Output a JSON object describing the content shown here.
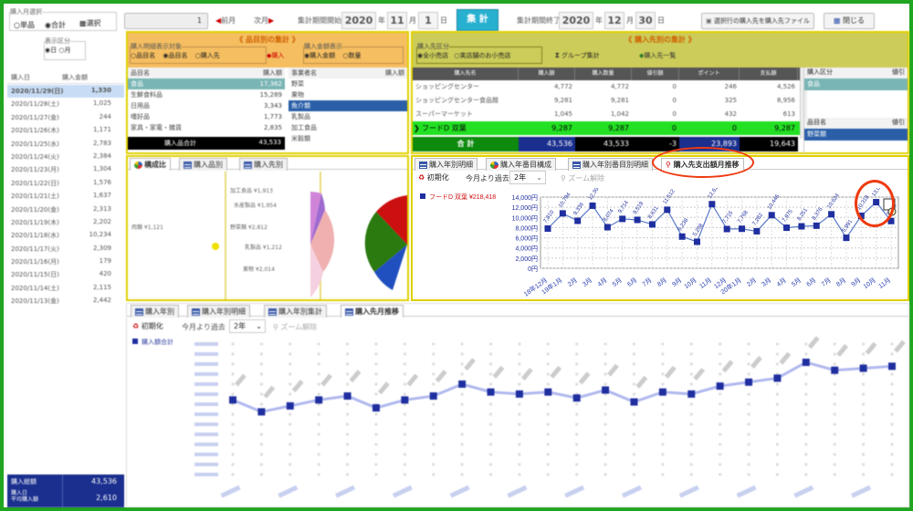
{
  "top": {
    "group1_legend": "購入月選択",
    "radio1": "単品",
    "radio2": "合計",
    "btn_cal": "選択",
    "field_left": "1",
    "nav_prev": "前月",
    "nav_next": "次月",
    "start_label": "集計期間開始",
    "start_year": "2020",
    "start_month": "11",
    "start_day": "1",
    "unit_year": "年",
    "unit_month": "月",
    "unit_day": "日",
    "aggregate_button": "集 計",
    "end_label": "集計期間終了",
    "end_year": "2020",
    "end_month": "12",
    "end_day": "30",
    "btn_export": "選択行の購入先を購入先ファイル出力",
    "btn_close": "閉じる"
  },
  "left": {
    "radio_legend": "表示区分",
    "radio_a": "日",
    "radio_b": "月",
    "col_date": "購入日",
    "col_amount": "購入金額",
    "rows": [
      {
        "date": "2020/11/29(日)",
        "amount": "1,330"
      },
      {
        "date": "2020/11/28(土)",
        "amount": "1,025"
      },
      {
        "date": "2020/11/27(金)",
        "amount": "244"
      },
      {
        "date": "2020/11/26(木)",
        "amount": "1,171"
      },
      {
        "date": "2020/11/25(水)",
        "amount": "2,783"
      },
      {
        "date": "2020/11/24(火)",
        "amount": "2,384"
      },
      {
        "date": "2020/11/23(月)",
        "amount": "1,304"
      },
      {
        "date": "2020/11/22(日)",
        "amount": "1,576"
      },
      {
        "date": "2020/11/21(土)",
        "amount": "1,637"
      },
      {
        "date": "2020/11/20(金)",
        "amount": "2,313"
      },
      {
        "date": "2020/11/19(木)",
        "amount": "2,202"
      },
      {
        "date": "2020/11/18(水)",
        "amount": "10,234"
      },
      {
        "date": "2020/11/17(火)",
        "amount": "2,309"
      },
      {
        "date": "2020/11/16(月)",
        "amount": "179"
      },
      {
        "date": "2020/11/15(日)",
        "amount": "420"
      },
      {
        "date": "2020/11/14(土)",
        "amount": "2,115"
      },
      {
        "date": "2020/11/13(金)",
        "amount": "2,442"
      }
    ],
    "total_label": "購入総額",
    "total_value": "43,536",
    "avg_label": "購入日\n平均購入額",
    "avg_value": "2,610"
  },
  "mid": {
    "header": "《 品目別の集計 》",
    "group_legend": "購入明細表示対象",
    "opt1": "品目名",
    "opt2": "品目名",
    "opt3": "購入先",
    "group2_legend": "購入金額表示",
    "opt4": "購入金額",
    "opt5": "数量",
    "col1": "品目名",
    "col2": "購入額",
    "rows": [
      {
        "name": "食品",
        "amount": "17,362"
      },
      {
        "name": "生鮮食料品",
        "amount": "15,289"
      },
      {
        "name": "日用品",
        "amount": "3,343"
      },
      {
        "name": "嗜好品",
        "amount": "1,773"
      },
      {
        "name": "家具・家電・雑貨",
        "amount": "2,835"
      }
    ],
    "total_label": "購入品合計",
    "total_value": "43,533",
    "sub_col": "事業者名",
    "sub_col2": "購入額",
    "sub_rows": [
      "野菜",
      "果物",
      "魚介類",
      "乳製品",
      "加工食品",
      "米穀類"
    ]
  },
  "right": {
    "header": "《 購入先別の集計 》",
    "legend": "購入先区分",
    "opt1": "全小売店",
    "opt2": "実店舗のお小売店",
    "btn_group": "グループ集計",
    "btn_single": "購入先一覧",
    "cols": [
      "購入先名",
      "購入額",
      "購入数量",
      "値引額",
      "ポイント",
      "支払額"
    ],
    "rows": [
      {
        "name": "ショッピングセンター",
        "amount": "4,772",
        "qty": "4,772",
        "disc": "0",
        "pt": "246",
        "pay": "4,526"
      },
      {
        "name": "ショッピングセンター食品館",
        "amount": "9,281",
        "qty": "9,281",
        "disc": "0",
        "pt": "325",
        "pay": "8,956"
      },
      {
        "name": "スーパーマーケット",
        "amount": "1,045",
        "qty": "1,042",
        "disc": "0",
        "pt": "432",
        "pay": "613"
      },
      {
        "name": "フードD 双葉",
        "amount": "9,287",
        "qty": "9,287",
        "disc": "0",
        "pt": "0",
        "pay": "9,287"
      }
    ],
    "total_label": "合 計",
    "total_amount": "43,536",
    "total_qty": "43,533",
    "total_disc": "-3",
    "total_pt": "23,893",
    "total_pay": "19,643",
    "side_col": "購入区分",
    "side_col2": "値引",
    "side_row": "食品",
    "side_col3": "品目名",
    "side_col4": "値引",
    "side_row2": "野菜類"
  },
  "tabs_small": {
    "t1": "構成比",
    "t2": "購入品別",
    "t3": "購入先別",
    "pie_labels": [
      "加工食品 ¥1,913",
      "水産製品 ¥1,954",
      "野菜類 ¥2,812",
      "乳製品 ¥1,212",
      "果物 ¥2,014",
      "肉類 ¥1,121"
    ]
  },
  "chart_tabs": {
    "t1": "購入年別明細",
    "t2": "購入年番目構成",
    "t3": "購入年別番目別明細",
    "t4": "購入先支出額月推移",
    "init": "初期化",
    "period_label": "今月より過去",
    "period_value": "2年",
    "zoom_reset": "ズーム解除"
  },
  "chart_data": [
    {
      "type": "line",
      "series": [
        {
          "name": "フードD 双葉 ¥218,418",
          "values": [
            7810,
            10794,
            9336,
            12304,
            8074,
            9714,
            9519,
            8631,
            11512,
            6238,
            5208,
            12611,
            7715,
            7768,
            7282,
            10445,
            7975,
            8251,
            8376,
            10624,
            5991,
            10318,
            13004,
            9287
          ]
        }
      ],
      "categories": [
        "18年12月",
        "19年1月",
        "2月",
        "3月",
        "4月",
        "5月",
        "6月",
        "7月",
        "8月",
        "9月",
        "10月",
        "11月",
        "12月",
        "20年1月",
        "2月",
        "3月",
        "4月",
        "5月",
        "6月",
        "7月",
        "8月",
        "9月",
        "10月",
        "11月"
      ],
      "ylim": [
        0,
        14000
      ],
      "yticks": [
        "0円",
        "2,000円",
        "4,000円",
        "6,000円",
        "8,000円",
        "10,000円",
        "12,000円",
        "14,000円"
      ],
      "color": "#1f2fa0"
    },
    {
      "type": "line",
      "series": [
        {
          "name": "購入額合計",
          "values": [
            3900,
            3300,
            3600,
            3900,
            4100,
            3500,
            3900,
            4100,
            4700,
            4300,
            4200,
            4300,
            4000,
            4400,
            3800,
            4300,
            4200,
            4600,
            4800,
            5000,
            5800,
            5400,
            5500,
            5600
          ]
        }
      ],
      "ylim": [
        0,
        7000
      ],
      "color": "#1f2fa0"
    }
  ],
  "bottom_tabs": {
    "t1": "購入年別",
    "t2": "購入年別明細",
    "t3": "購入年別集計",
    "t4": "購入先月推移",
    "init": "初期化",
    "period": "今月より過去",
    "period_val": "2年",
    "zoom": "ズーム解除",
    "legend": "購入額合計"
  }
}
